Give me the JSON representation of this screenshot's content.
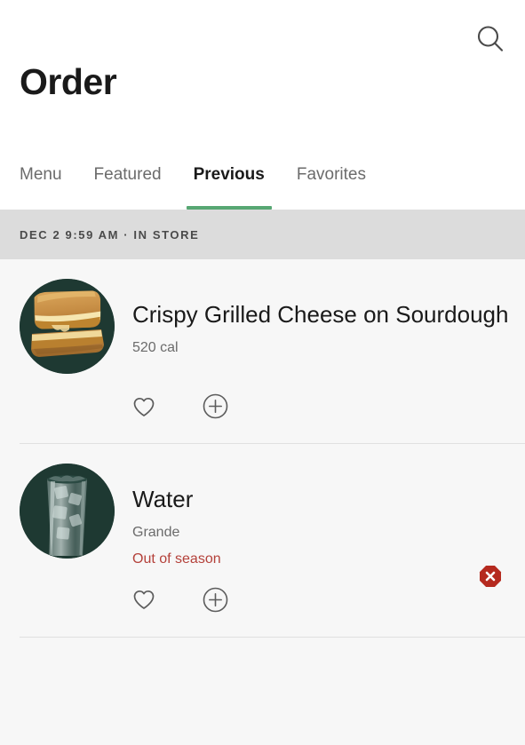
{
  "header": {
    "title": "Order",
    "search_icon": "search-icon"
  },
  "tabs": [
    {
      "label": "Menu",
      "active": false
    },
    {
      "label": "Featured",
      "active": false
    },
    {
      "label": "Previous",
      "active": true
    },
    {
      "label": "Favorites",
      "active": false
    }
  ],
  "order_group": {
    "date_label": "DEC 2 9:59 AM · IN STORE"
  },
  "items": [
    {
      "title": "Crispy Grilled Cheese on Sourdough",
      "subtitle": "520 cal",
      "status": "",
      "image": "grilled-cheese-sandwich",
      "favorite_icon": "heart-icon",
      "add_icon": "plus-circle-icon",
      "error_icon": ""
    },
    {
      "title": "Water",
      "subtitle": "Grande",
      "status": "Out of season",
      "image": "iced-water-glass",
      "favorite_icon": "heart-icon",
      "add_icon": "plus-circle-icon",
      "error_icon": "error-octagon-icon"
    }
  ],
  "colors": {
    "accent_green": "#57a773",
    "thumb_background": "#1e3932",
    "error_red": "#b52a1f",
    "status_red": "#b4413a",
    "date_bar": "#dcdcdc",
    "list_background": "#f7f7f7"
  }
}
